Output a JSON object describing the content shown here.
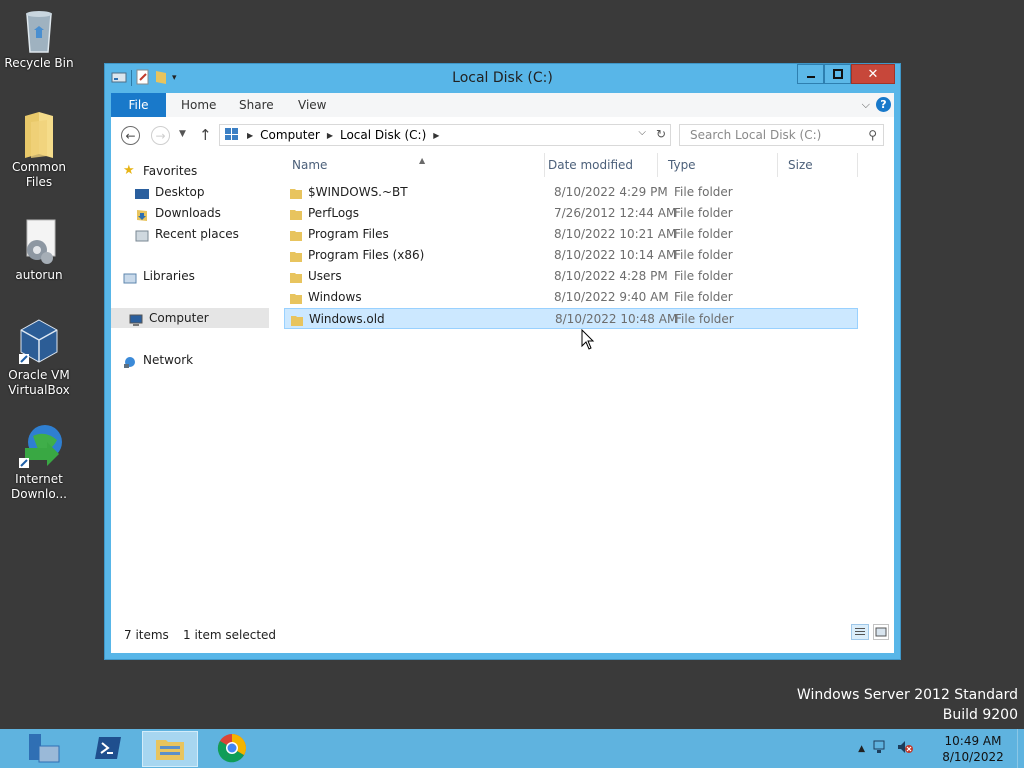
{
  "desktop": {
    "icons": [
      {
        "label": "Recycle Bin",
        "icon": "recycle-bin-icon"
      },
      {
        "label": "Common Files",
        "icon": "folder-icon"
      },
      {
        "label": "autorun",
        "icon": "settings-file-icon"
      },
      {
        "label": "Oracle VM VirtualBox",
        "icon": "virtualbox-icon"
      },
      {
        "label": "Internet Downlo...",
        "icon": "internet-download-manager-icon"
      }
    ],
    "watermark_line1": "Windows Server 2012 Standard",
    "watermark_line2": "Build 9200"
  },
  "window": {
    "title": "Local Disk (C:)",
    "ribbon_tabs": {
      "file": "File",
      "home": "Home",
      "share": "Share",
      "view": "View"
    },
    "address": {
      "crumbs": [
        "Computer",
        "Local Disk (C:)"
      ]
    },
    "search_placeholder": "Search Local Disk (C:)",
    "nav_pane": {
      "favorites": "Favorites",
      "desktop": "Desktop",
      "downloads": "Downloads",
      "recent_places": "Recent places",
      "libraries": "Libraries",
      "computer": "Computer",
      "network": "Network"
    },
    "columns": {
      "name": "Name",
      "date": "Date modified",
      "type": "Type",
      "size": "Size"
    },
    "files": [
      {
        "name": "$WINDOWS.~BT",
        "date": "8/10/2022 4:29 PM",
        "type": "File folder"
      },
      {
        "name": "PerfLogs",
        "date": "7/26/2012 12:44 AM",
        "type": "File folder"
      },
      {
        "name": "Program Files",
        "date": "8/10/2022 10:21 AM",
        "type": "File folder"
      },
      {
        "name": "Program Files (x86)",
        "date": "8/10/2022 10:14 AM",
        "type": "File folder"
      },
      {
        "name": "Users",
        "date": "8/10/2022 4:28 PM",
        "type": "File folder"
      },
      {
        "name": "Windows",
        "date": "8/10/2022 9:40 AM",
        "type": "File folder"
      },
      {
        "name": "Windows.old",
        "date": "8/10/2022 10:48 AM",
        "type": "File folder",
        "selected": true
      }
    ],
    "status": {
      "items": "7 items",
      "selected": "1 item selected"
    }
  },
  "taskbar": {
    "apps": [
      "server-manager-icon",
      "powershell-icon",
      "file-explorer-icon",
      "chrome-icon"
    ],
    "clock_time": "10:49 AM",
    "clock_date": "8/10/2022"
  },
  "colors": {
    "accent": "#1979ca",
    "window_frame": "#58b6e8",
    "taskbar": "#5fb3df",
    "selection": "#cce8ff"
  }
}
